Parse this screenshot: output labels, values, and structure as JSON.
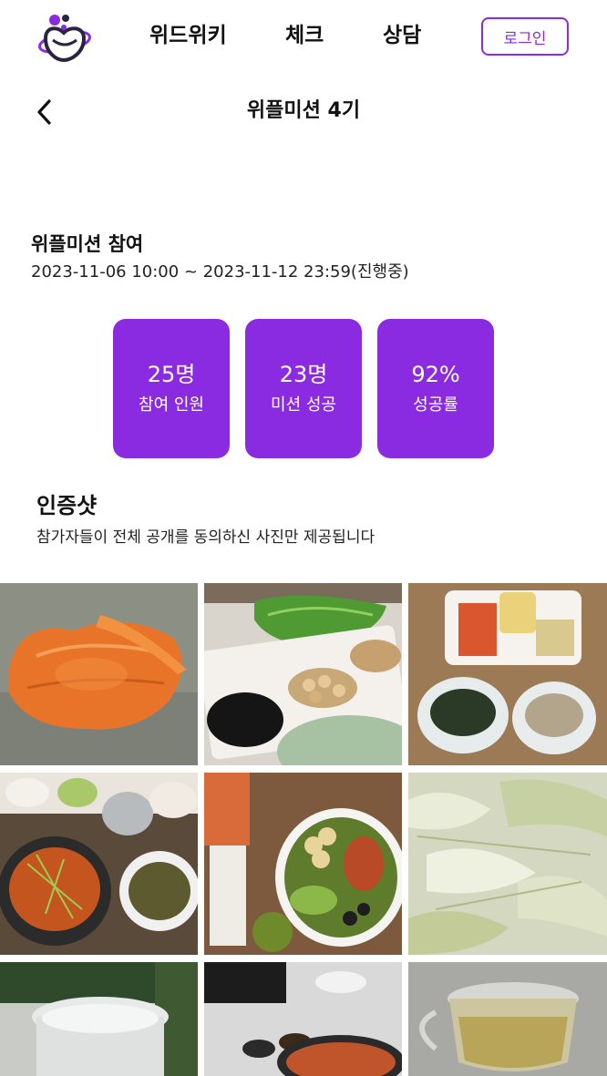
{
  "header": {
    "nav": [
      "위드위키",
      "체크",
      "상담"
    ],
    "login_label": "로그인"
  },
  "page": {
    "title": "위플미션 4기"
  },
  "participation": {
    "title": "위플미션 참여",
    "period": "2023-11-06 10:00 ~ 2023-11-12 23:59(진행중)"
  },
  "stats": [
    {
      "value": "25명",
      "label": "참여 인원"
    },
    {
      "value": "23명",
      "label": "미션 성공"
    },
    {
      "value": "92%",
      "label": "성공률"
    }
  ],
  "certification": {
    "title": "인증샷",
    "description": "참가자들이 전체 공개를 동의하신 사진만 제공됩니다"
  },
  "colors": {
    "accent": "#8a2be2"
  }
}
